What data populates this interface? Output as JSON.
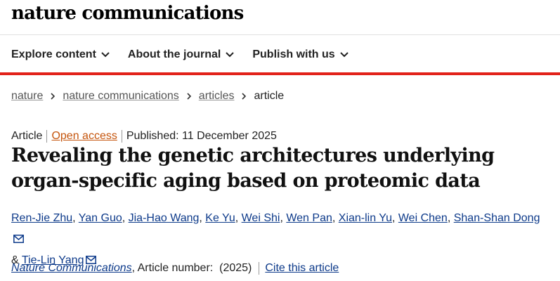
{
  "header": {
    "brand": "nature communications"
  },
  "nav": {
    "items": [
      {
        "label": "Explore content"
      },
      {
        "label": "About the journal"
      },
      {
        "label": "Publish with us"
      }
    ]
  },
  "breadcrumb": {
    "items": [
      "nature",
      "nature communications",
      "articles"
    ],
    "current": "article"
  },
  "article": {
    "type": "Article",
    "access": "Open access",
    "published": "Published: 11 December 2025",
    "title": "Revealing the genetic architectures underlying organ-specific aging based on proteomic data",
    "authors": [
      "Ren-Jie Zhu",
      "Yan Guo",
      "Jia-Hao Wang",
      "Ke Yu",
      "Wei Shi",
      "Wen Pan",
      "Xian-lin Yu",
      "Wei Chen",
      "Shan-Shan Dong",
      "Tie-Lin Yang"
    ],
    "author_separator": ", ",
    "last_separator": "& ",
    "journal": "Nature Communications",
    "article_number": ", Article number:  (2025)",
    "cite": "Cite this article"
  },
  "colors": {
    "accent_red": "#e2231a",
    "link_blue": "#0d3a8a",
    "open_access_orange": "#c5550d"
  },
  "icons": {
    "nav_dropdown": "chevron-down-icon",
    "breadcrumb_sep": "chevron-right-icon",
    "contact": "mail-icon"
  }
}
